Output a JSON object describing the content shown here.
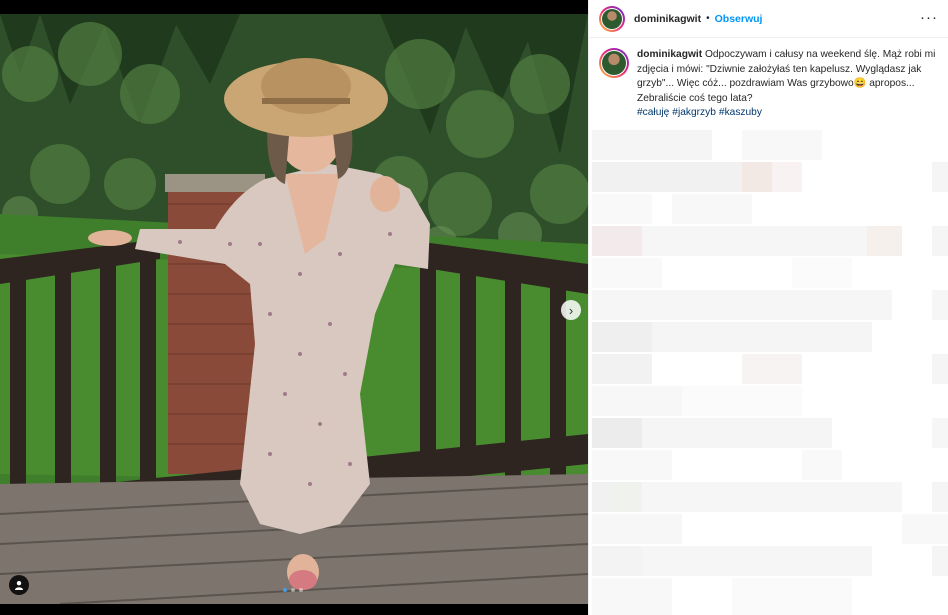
{
  "post": {
    "username": "dominikagwit",
    "separator": "•",
    "follow_label": "Obserwuj",
    "more_icon": "more-options-icon",
    "more_label": "···",
    "caption_text": "Odpoczywam i całusy na weekend ślę. Mąż robi mi zdjęcia i mówi: \"Dziwnie założyłaś ten kapelusz. Wyglądasz jak grzyb\"... Więc cóż... pozdrawiam Was grzybowo",
    "emoji": "😄",
    "caption_text_2": "apropos... Zebraliście coś tego lata?",
    "hashtags": [
      "#całuję",
      "#jakgrzyb",
      "#kaszuby"
    ]
  },
  "media": {
    "next_icon": "chevron-right-icon",
    "next_label": "›",
    "tag_icon": "user-tag-icon",
    "carousel_count": 3,
    "carousel_active": 1
  },
  "colors": {
    "accent": "#0095f6",
    "hashtag": "#00376b",
    "text": "#262626"
  }
}
